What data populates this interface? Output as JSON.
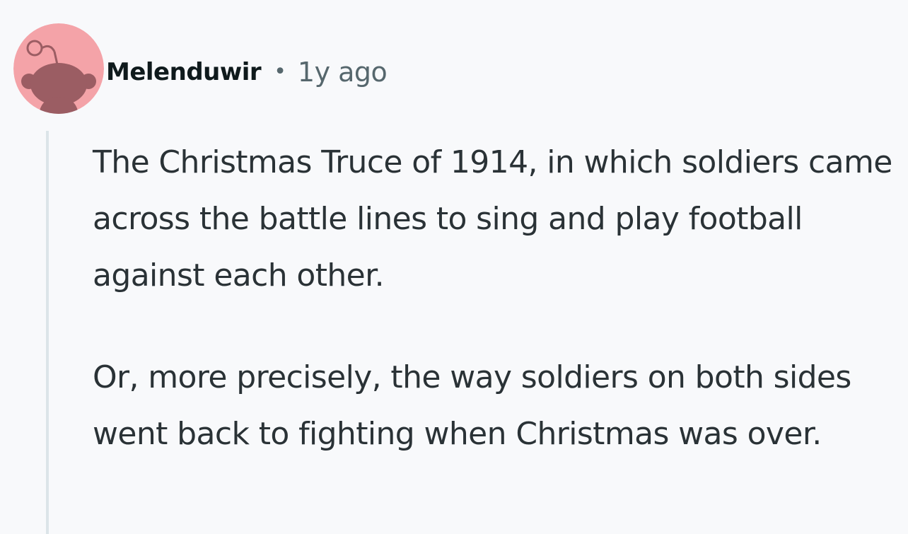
{
  "comment": {
    "author": "Melenduwir",
    "separator": "•",
    "timestamp": "1y ago",
    "avatar_icon": "reddit-snoo-avatar-icon",
    "avatar_color": "#f4a3a8",
    "paragraphs": [
      "The Christmas Truce of 1914, in which soldiers came across the battle lines to sing and play football against each other.",
      "Or, more precisely, the way soldiers on both sides went back to fighting when Christmas was over."
    ]
  }
}
